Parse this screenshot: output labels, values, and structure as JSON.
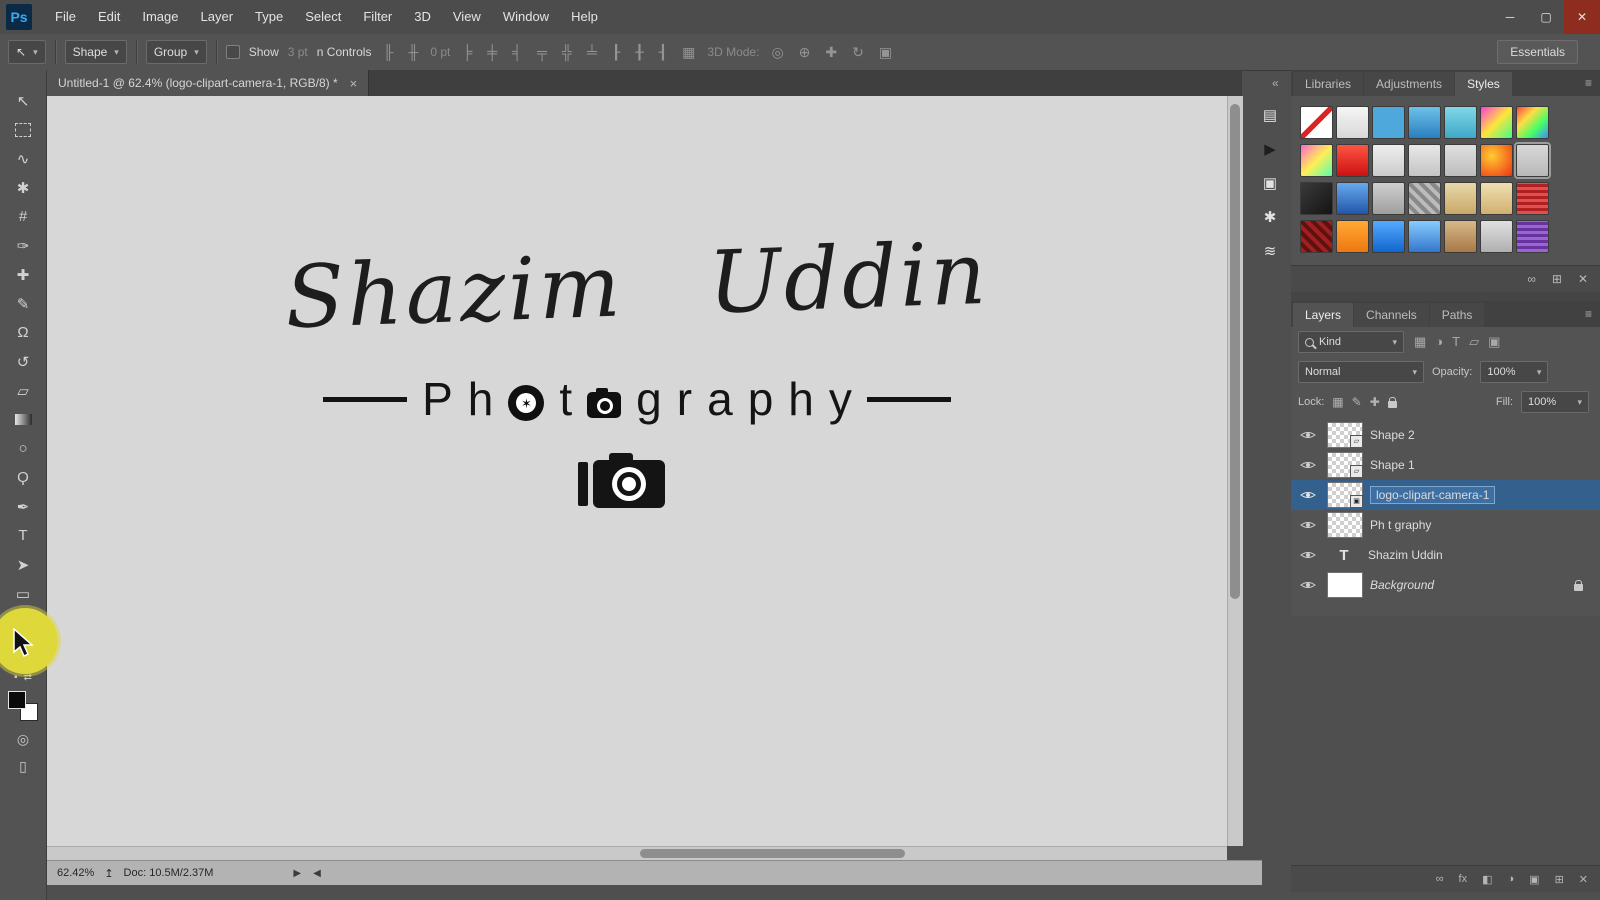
{
  "ui": {
    "caret": "▾",
    "collapse": "«"
  },
  "menubar": {
    "logo": "Ps",
    "items": [
      "File",
      "Edit",
      "Image",
      "Layer",
      "Type",
      "Select",
      "Filter",
      "3D",
      "View",
      "Window",
      "Help"
    ],
    "window_controls": {
      "minimize": "─",
      "restore": "▢",
      "close": "✕"
    }
  },
  "options": {
    "tool_glyph": "↖",
    "shape": "Shape",
    "group": "Group",
    "show": "Show",
    "dim_field_1": "3 pt",
    "dim_field_2": "0 pt",
    "controls": "n Controls",
    "align_icons_a": [
      "╟",
      "╫"
    ],
    "align_icons_b": [
      "╞",
      "╪",
      "╡"
    ],
    "align_icons_c": [
      "╤",
      "╬",
      "╧"
    ],
    "align_icons_d": [
      "┠",
      "╂",
      "┨"
    ],
    "grid_icon": "▦",
    "three_d_label": "3D Mode:",
    "three_d_icons": [
      "◎",
      "⊕",
      "✚",
      "↻",
      "▣"
    ],
    "workspace": "Essentials"
  },
  "toolbar": {
    "tools": [
      {
        "name": "move-tool",
        "glyph": "↖"
      },
      {
        "name": "marquee-tool",
        "glyph": ""
      },
      {
        "name": "lasso-tool",
        "glyph": "∿"
      },
      {
        "name": "quick-selection-tool",
        "glyph": "✱"
      },
      {
        "name": "crop-tool",
        "glyph": "#"
      },
      {
        "name": "eyedropper-tool",
        "glyph": "✑"
      },
      {
        "name": "healing-brush-tool",
        "glyph": "✚"
      },
      {
        "name": "brush-tool",
        "glyph": "✎"
      },
      {
        "name": "clone-stamp-tool",
        "glyph": "Ω"
      },
      {
        "name": "history-brush-tool",
        "glyph": "↺"
      },
      {
        "name": "eraser-tool",
        "glyph": "▱"
      },
      {
        "name": "gradient-tool",
        "glyph": ""
      },
      {
        "name": "blur-tool",
        "glyph": "○"
      },
      {
        "name": "dodge-tool",
        "glyph": "Ϙ"
      },
      {
        "name": "pen-tool",
        "glyph": "✒"
      },
      {
        "name": "type-tool",
        "glyph": "T"
      },
      {
        "name": "path-selection-tool",
        "glyph": "➤"
      },
      {
        "name": "rectangle-tool",
        "glyph": "▭"
      },
      {
        "name": "hand-tool",
        "glyph": "✌"
      },
      {
        "name": "zoom-tool",
        "glyph": ""
      }
    ],
    "swap_icon": "⇄",
    "default_colors_icon": "▪",
    "quick_mask_icon": "◎",
    "screen_mode_icon": "▯"
  },
  "document": {
    "tab_title": "Untitled-1 @ 62.4% (logo-clipart-camera-1, RGB/8) *",
    "close": "×"
  },
  "canvas": {
    "signature": "Shazim Uddin",
    "aperture_glyph": "✶",
    "word": {
      "l1": "P",
      "l2": "h",
      "l3": "t",
      "l4": "g",
      "l5": "r",
      "l6": "a",
      "l7": "p",
      "l8": "h",
      "l9": "y"
    }
  },
  "statusbar": {
    "zoom": "62.42%",
    "export_icon": "↥",
    "doc": "Doc: 10.5M/2.37M",
    "nav_fwd": "▶",
    "nav_back": "◀"
  },
  "panelstrip": {
    "icons": [
      {
        "name": "history-panel-icon",
        "glyph": "▤"
      },
      {
        "name": "actions-panel-icon",
        "glyph": "▶"
      },
      {
        "name": "clone-source-panel-icon",
        "glyph": "▣"
      },
      {
        "name": "brush-presets-panel-icon",
        "glyph": "✱"
      },
      {
        "name": "character-panel-icon",
        "glyph": "≋"
      }
    ]
  },
  "panels": {
    "tabs": [
      "Libraries",
      "Adjustments",
      "Styles"
    ],
    "panel_menu_icon": "≡",
    "styles": [
      "linear-gradient(135deg,#ffffff 44%,#dd2222 44%,#dd2222 56%,#ffffff 56%)",
      "linear-gradient(#f5f5f5,#d8d8d8)",
      "#4fa8dc",
      "linear-gradient(#6cc1e8,#2a7fc0)",
      "linear-gradient(#7fd8e8,#3fa8c8)",
      "linear-gradient(135deg,#ff3cd8,#ffe43c,#3cff88)",
      "linear-gradient(135deg,#ff4444,#ffdd44,#44ff66,#4488ff)",
      "linear-gradient(135deg,#ff66cc,#ffee55,#55ffaa)",
      "linear-gradient(#ff5544,#cc1111)",
      "linear-gradient(#eeeeee,#cccccc)",
      "linear-gradient(#e8e8e8,#c4c4c4)",
      "linear-gradient(#e0e0e0,#bdbdbd)",
      "radial-gradient(circle at 35% 35%,#ffcc33,#ee3311)",
      "linear-gradient(#d8d8d8,#b8b8b8)",
      "linear-gradient(135deg,#3a3a3a,#141414)",
      "linear-gradient(#66aaee,#2255aa)",
      "linear-gradient(#cfcfcf,#9f9f9f)",
      "repeating-linear-gradient(45deg,#bbbbbb 0 4px,#888888 4px 8px)",
      "linear-gradient(#e8d8a8,#c8a868)",
      "linear-gradient(#f0e0b0,#d0b070)",
      "repeating-linear-gradient(0deg,#e05050 0 3px,#b02020 3px 6px)",
      "repeating-linear-gradient(45deg,#a02020 0 4px,#601010 4px 8px)",
      "linear-gradient(#ffaa33,#ee7711)",
      "linear-gradient(#55aaff,#1166cc)",
      "linear-gradient(#88ccff,#3377cc)",
      "linear-gradient(#d8b888,#a87848)",
      "linear-gradient(#e0e0e0,#b0b0b0)",
      "repeating-linear-gradient(0deg,#9966cc 0 3px,#6633a0 3px 6px)"
    ],
    "styles_footer_icons": {
      "clear": "∞",
      "new": "⊞",
      "delete": "✕"
    },
    "layers_tabs": [
      "Layers",
      "Channels",
      "Paths"
    ],
    "kind": "Kind",
    "filter_icons": [
      "▦",
      "◑",
      "T",
      "▱",
      "▣"
    ],
    "blend": "Normal",
    "opacity_label": "Opacity:",
    "opacity": "100%",
    "lock_label": "Lock:",
    "lock_icons": [
      "▦",
      "✎",
      "✚"
    ],
    "fill_label": "Fill:",
    "fill": "100%",
    "layers": [
      {
        "name": "Shape 2",
        "badge": "▱"
      },
      {
        "name": "Shape 1",
        "badge": "▱"
      },
      {
        "name": "logo-clipart-camera-1",
        "badge": "▣"
      },
      {
        "name": "Ph t graphy"
      },
      {
        "name": "Shazim Uddin",
        "thumb_glyph": "T"
      },
      {
        "name": "Background"
      }
    ],
    "footer_icons": [
      "∞",
      "fx",
      "◧",
      "◑",
      "▣",
      "⊞",
      "✕"
    ]
  }
}
